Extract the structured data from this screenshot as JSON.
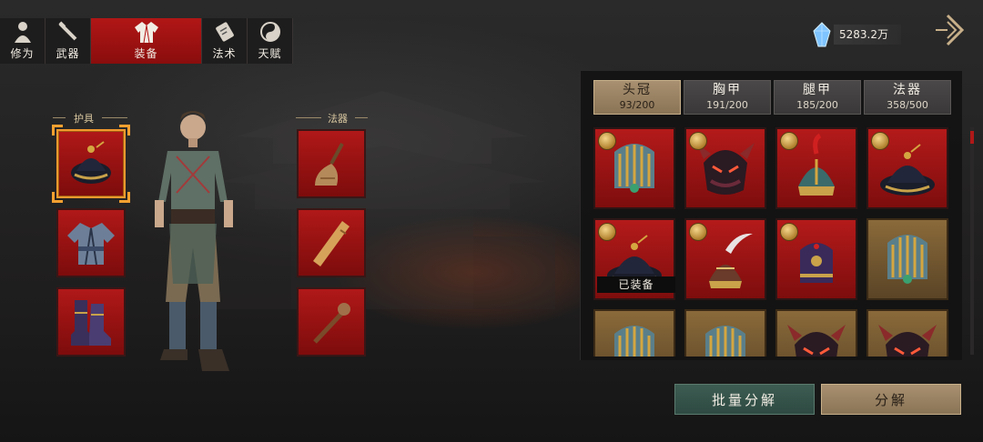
{
  "top_tabs": [
    {
      "label": "修为",
      "icon": "cultivation-figure-icon",
      "active": false
    },
    {
      "label": "武器",
      "icon": "weapon-icon",
      "active": false
    },
    {
      "label": "装备",
      "icon": "robe-icon",
      "active": true
    },
    {
      "label": "法术",
      "icon": "spell-scroll-icon",
      "active": false
    },
    {
      "label": "天赋",
      "icon": "yin-yang-icon",
      "active": false
    }
  ],
  "currency": {
    "icon": "crystal-gem-icon",
    "amount": "5283.2万"
  },
  "equip_panel": {
    "left_group_label": "护具",
    "right_group_label": "法器",
    "left_slots": [
      {
        "name": "helmet-slot",
        "icon": "helmet-icon",
        "selected": true
      },
      {
        "name": "chest-armor-slot",
        "icon": "chest-armor-icon",
        "selected": false
      },
      {
        "name": "boots-slot",
        "icon": "boots-icon",
        "selected": false
      }
    ],
    "right_slots": [
      {
        "name": "whisk-slot",
        "icon": "whisk-icon"
      },
      {
        "name": "scroll-slot",
        "icon": "bamboo-scroll-icon"
      },
      {
        "name": "staff-slot",
        "icon": "staff-icon"
      }
    ]
  },
  "inventory": {
    "tabs": [
      {
        "name": "头冠",
        "count": "93/200",
        "active": true
      },
      {
        "name": "胸甲",
        "count": "191/200",
        "active": false
      },
      {
        "name": "腿甲",
        "count": "185/200",
        "active": false
      },
      {
        "name": "法器",
        "count": "358/500",
        "active": false
      }
    ],
    "equipped_label": "已装备",
    "items": [
      {
        "icon": "jade-crown-icon",
        "rarity": "red",
        "coin": true,
        "equipped": false
      },
      {
        "icon": "demon-mask-helmet-icon",
        "rarity": "red",
        "coin": true,
        "equipped": false
      },
      {
        "icon": "plumed-war-helmet-icon",
        "rarity": "red",
        "coin": true,
        "equipped": false
      },
      {
        "icon": "black-gauze-hat-icon",
        "rarity": "red",
        "coin": true,
        "equipped": false
      },
      {
        "icon": "black-gauze-hat-icon",
        "rarity": "red",
        "coin": true,
        "equipped": true
      },
      {
        "icon": "feather-helmet-icon",
        "rarity": "red",
        "coin": true,
        "equipped": false
      },
      {
        "icon": "purple-official-hat-icon",
        "rarity": "red",
        "coin": true,
        "equipped": false
      },
      {
        "icon": "jade-crown-icon",
        "rarity": "gold",
        "coin": false,
        "equipped": false
      },
      {
        "icon": "jade-crown-icon",
        "rarity": "gold",
        "coin": false,
        "equipped": false
      },
      {
        "icon": "jade-crown-icon",
        "rarity": "gold",
        "coin": false,
        "equipped": false
      },
      {
        "icon": "demon-mask-helmet-icon",
        "rarity": "gold",
        "coin": false,
        "equipped": false
      },
      {
        "icon": "demon-mask-helmet-icon",
        "rarity": "gold",
        "coin": false,
        "equipped": false
      }
    ]
  },
  "buttons": {
    "batch_decompose": "批量分解",
    "decompose": "分解"
  }
}
